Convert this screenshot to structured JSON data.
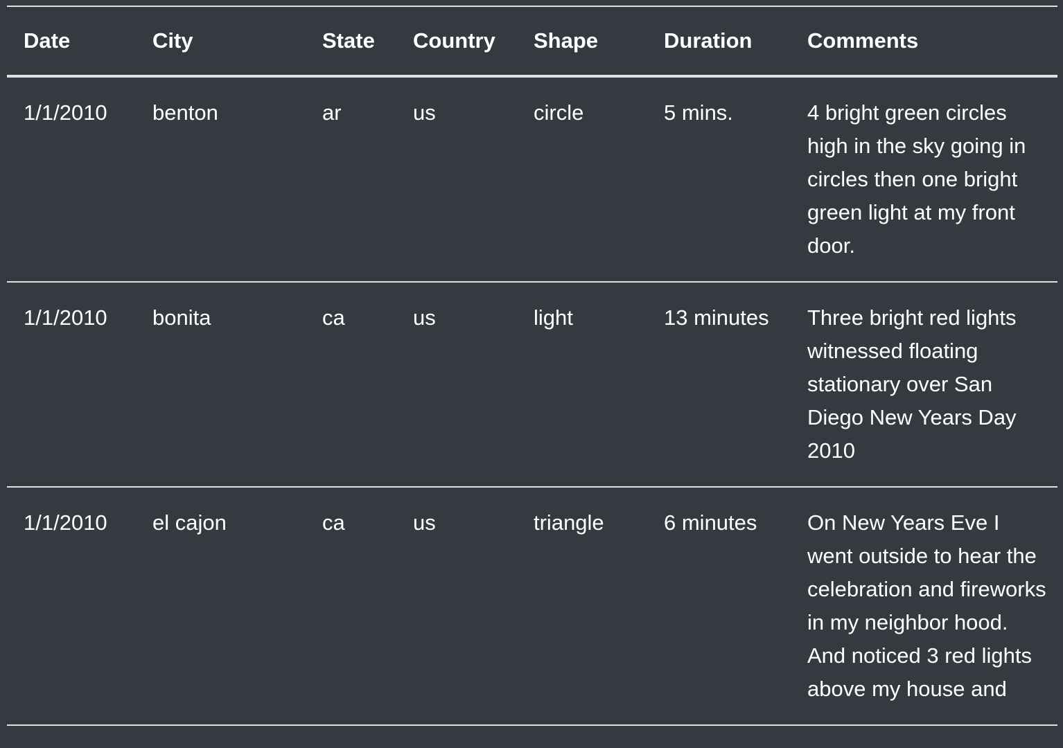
{
  "table": {
    "columns": [
      "Date",
      "City",
      "State",
      "Country",
      "Shape",
      "Duration",
      "Comments"
    ],
    "rows": [
      {
        "date": "1/1/2010",
        "city": "benton",
        "state": "ar",
        "country": "us",
        "shape": "circle",
        "duration": "5 mins.",
        "comments": "4 bright green circles high in the sky going in circles then one bright green light at my front door."
      },
      {
        "date": "1/1/2010",
        "city": "bonita",
        "state": "ca",
        "country": "us",
        "shape": "light",
        "duration": "13 minutes",
        "comments": "Three bright red lights witnessed floating stationary over San Diego New Years Day 2010"
      },
      {
        "date": "1/1/2010",
        "city": "el cajon",
        "state": "ca",
        "country": "us",
        "shape": "triangle",
        "duration": "6 minutes",
        "comments": "On New Years Eve I went outside to hear the celebration and fireworks in my neighbor hood. And noticed 3 red lights above my house and"
      }
    ]
  },
  "colors": {
    "background": "#343a40",
    "text": "#ffffff",
    "border": "#dee2e6"
  }
}
